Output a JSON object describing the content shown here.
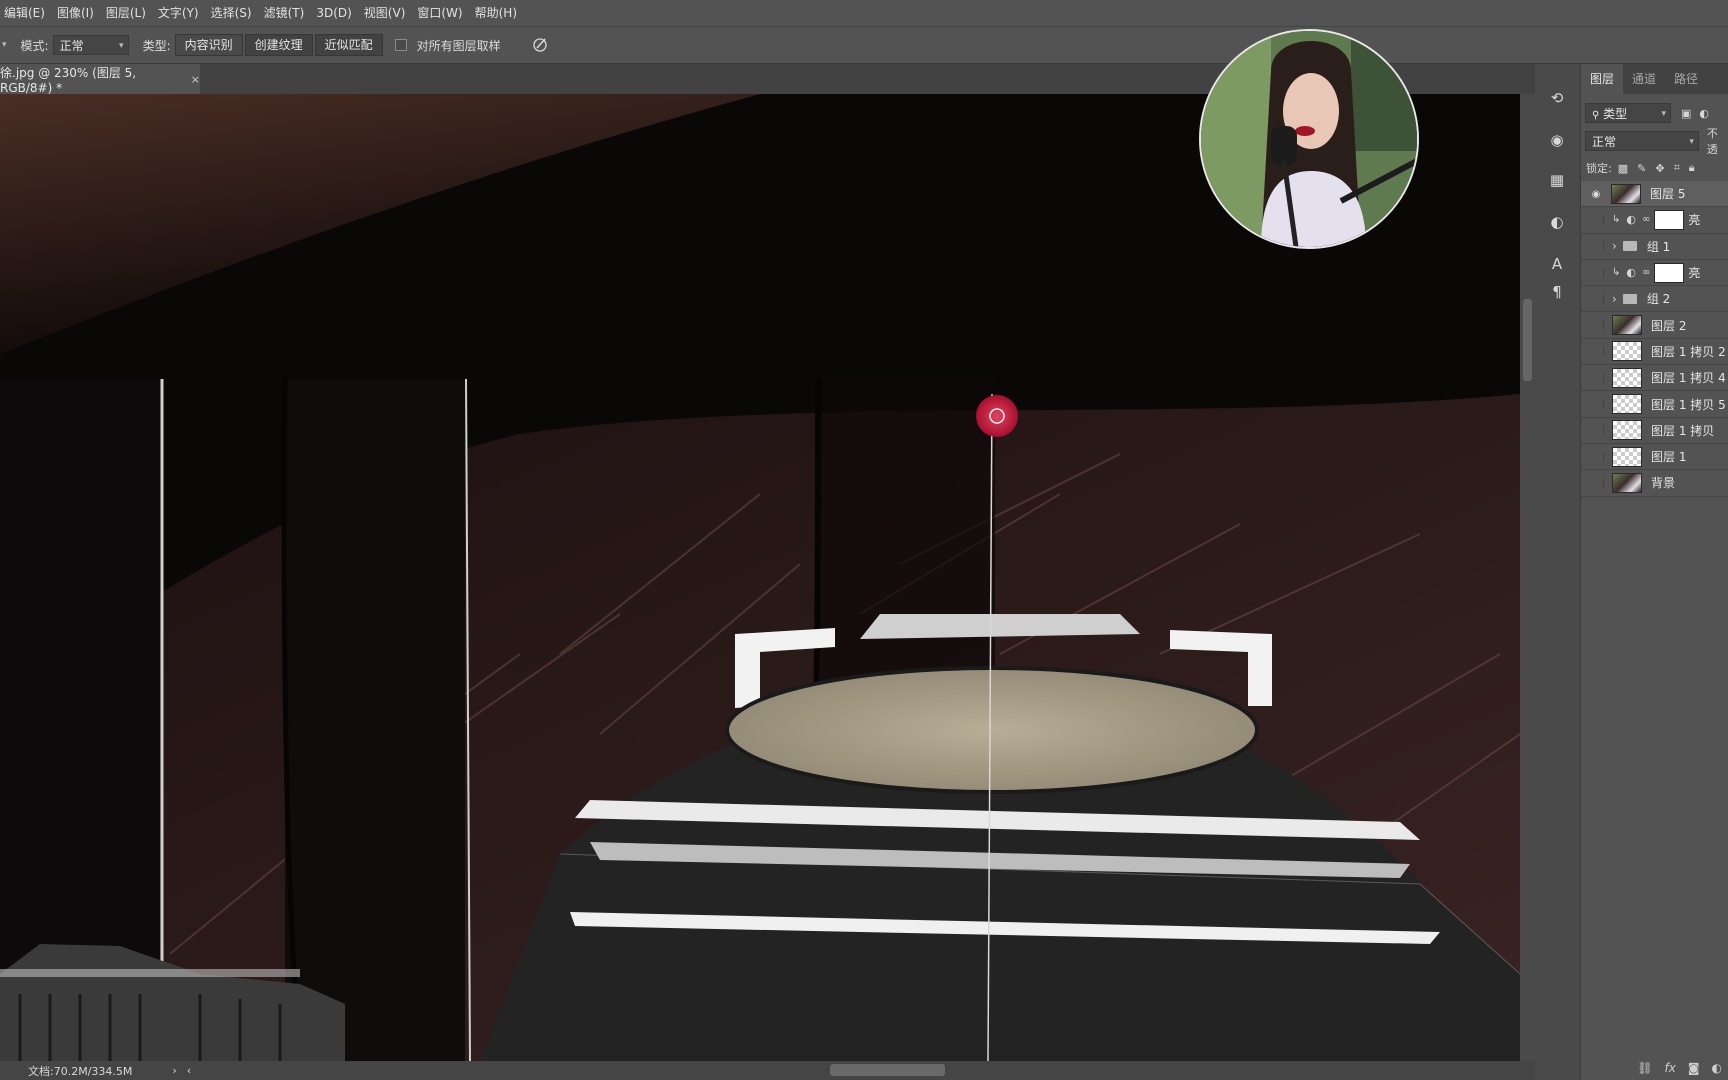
{
  "menu": {
    "items": [
      "编辑(E)",
      "图像(I)",
      "图层(L)",
      "文字(Y)",
      "选择(S)",
      "滤镜(T)",
      "3D(D)",
      "视图(V)",
      "窗口(W)",
      "帮助(H)"
    ]
  },
  "options": {
    "mode_label": "模式:",
    "mode_value": "正常",
    "type_label": "类型:",
    "type_buttons": [
      "内容识别",
      "创建纹理",
      "近似匹配"
    ],
    "sample_all_label": "对所有图层取样"
  },
  "document": {
    "tab_title": "徐.jpg @ 230% (图层 5, RGB/8#) *",
    "close_glyph": "×"
  },
  "status": {
    "doc_size": "文档:70.2M/334.5M",
    "arrow": "›",
    "arrow_left": "‹"
  },
  "layers_panel": {
    "tabs": [
      "图层",
      "通道",
      "路径"
    ],
    "filter_label": "类型",
    "blend_mode": "正常",
    "opacity_label": "不透",
    "lock_label": "锁定:",
    "layers": [
      {
        "name": "图层 5",
        "kind": "photo",
        "visible": true,
        "selected": true
      },
      {
        "name": "亮",
        "kind": "adjustment",
        "visible": false,
        "selected": false
      },
      {
        "name": "组 1",
        "kind": "group",
        "visible": false,
        "selected": false
      },
      {
        "name": "亮",
        "kind": "adjustment",
        "visible": false,
        "selected": false
      },
      {
        "name": "组 2",
        "kind": "group",
        "visible": false,
        "selected": false
      },
      {
        "name": "图层 2",
        "kind": "photo",
        "visible": false,
        "selected": false
      },
      {
        "name": "图层 1 拷贝 2",
        "kind": "transparent",
        "visible": false,
        "selected": false
      },
      {
        "name": "图层 1 拷贝 4",
        "kind": "transparent",
        "visible": false,
        "selected": false
      },
      {
        "name": "图层 1 拷贝 5",
        "kind": "transparent",
        "visible": false,
        "selected": false
      },
      {
        "name": "图层 1 拷贝",
        "kind": "transparent",
        "visible": false,
        "selected": false
      },
      {
        "name": "图层 1",
        "kind": "transparent",
        "visible": false,
        "selected": false
      },
      {
        "name": "背景",
        "kind": "photo",
        "visible": false,
        "selected": false
      }
    ],
    "footer_icons": [
      "link-icon",
      "fx-icon",
      "mask-icon",
      "adjustment-icon"
    ],
    "footer_fx": "fx"
  },
  "colors": {
    "ui_bg": "#535353",
    "brush_cursor": "#c4163a"
  }
}
